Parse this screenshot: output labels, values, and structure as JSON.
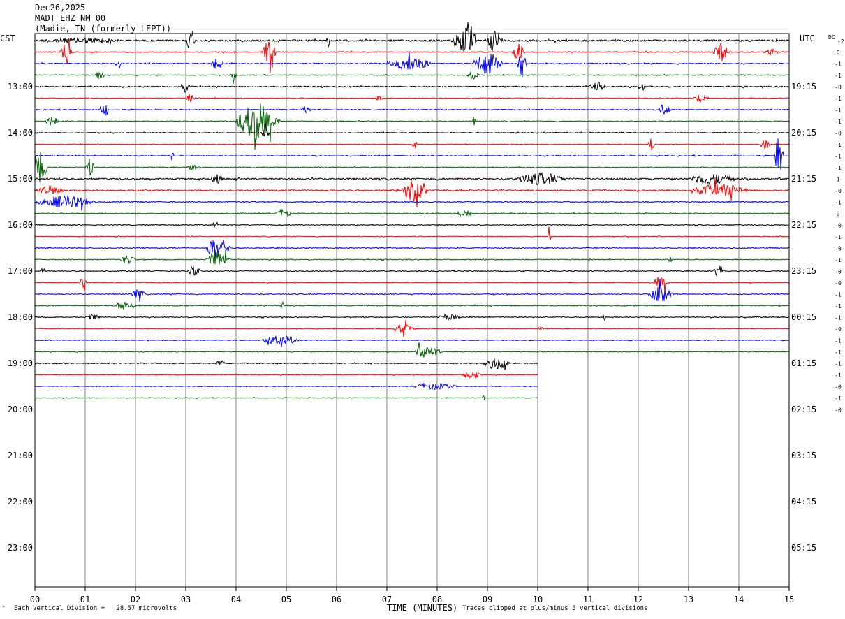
{
  "header": {
    "date": "Dec26,2025",
    "station": "MADT EHZ NM 00",
    "location": "(Madie, TN (formerly LEPT))"
  },
  "left_tz": "CST",
  "right_tz": "UTC",
  "dc_label": "DC",
  "dc_top_value": "-2",
  "footer": {
    "scale_note": "Each Vertical Division =   28.57 microvolts",
    "clip_note": "Traces clipped at plus/minus 5 vertical divisions",
    "corner_mark": "⌃"
  },
  "chart_data": {
    "type": "line",
    "title": "",
    "xlabel": "TIME (MINUTES)",
    "ylabel": "",
    "xlim": [
      0,
      15
    ],
    "x_ticks": [
      "00",
      "01",
      "02",
      "03",
      "04",
      "05",
      "06",
      "07",
      "08",
      "09",
      "10",
      "11",
      "12",
      "13",
      "14",
      "15"
    ],
    "hour_labels_left": [
      "13:00",
      "14:00",
      "15:00",
      "16:00",
      "17:00",
      "18:00",
      "19:00",
      "20:00",
      "21:00",
      "22:00",
      "23:00"
    ],
    "hour_labels_right": [
      "19:15",
      "20:15",
      "21:15",
      "22:15",
      "23:15",
      "00:15",
      "01:15",
      "02:15",
      "03:15",
      "04:15",
      "05:15"
    ],
    "first_hour_row": 4,
    "rows_per_hour": 4,
    "total_rows": 48,
    "trace_colors": [
      "#000000",
      "#ff0000",
      "#0000ff",
      "#006400"
    ],
    "dc_offsets": [
      "0",
      "-1",
      "-1",
      "-0",
      "-1",
      "-1",
      "-1",
      "-0",
      "-1",
      "-1",
      "-1",
      "1",
      "-0",
      "-1",
      "0",
      "-0",
      "-1",
      "-0",
      "-1",
      "-0",
      "-0",
      "-1",
      "-1",
      "-1",
      "-0",
      "-1",
      "-1",
      "-1",
      "-1",
      "-0",
      "-1",
      "-0"
    ],
    "traces": [
      {
        "row": 0,
        "end_minute": 15,
        "noise": 1.0,
        "events": [
          [
            0.0,
            3.0,
            2
          ],
          [
            3.0,
            0.3,
            6
          ],
          [
            8.3,
            0.8,
            9
          ],
          [
            9.0,
            0.5,
            8
          ],
          [
            5.8,
            0.1,
            5
          ]
        ]
      },
      {
        "row": 1,
        "end_minute": 15,
        "noise": 0.6,
        "events": [
          [
            0.5,
            0.4,
            6
          ],
          [
            4.5,
            0.5,
            7
          ],
          [
            9.5,
            0.4,
            6
          ],
          [
            13.5,
            0.5,
            7
          ],
          [
            14.5,
            0.5,
            2
          ]
        ]
      },
      {
        "row": 2,
        "end_minute": 15,
        "noise": 0.6,
        "events": [
          [
            1.6,
            0.2,
            4
          ],
          [
            3.5,
            0.4,
            5
          ],
          [
            7.0,
            1.5,
            4
          ],
          [
            8.7,
            1.0,
            7
          ],
          [
            9.6,
            0.3,
            10
          ]
        ]
      },
      {
        "row": 3,
        "end_minute": 15,
        "noise": 0.5,
        "events": [
          [
            1.2,
            0.3,
            3
          ],
          [
            3.9,
            0.2,
            3
          ],
          [
            8.6,
            0.4,
            3
          ]
        ]
      },
      {
        "row": 4,
        "end_minute": 15,
        "noise": 0.7,
        "events": [
          [
            2.9,
            0.3,
            4
          ],
          [
            11.0,
            0.6,
            3
          ],
          [
            12.0,
            0.2,
            4
          ]
        ]
      },
      {
        "row": 5,
        "end_minute": 15,
        "noise": 0.4,
        "events": [
          [
            3.0,
            0.3,
            3
          ],
          [
            6.8,
            0.2,
            4
          ],
          [
            13.1,
            0.5,
            3
          ]
        ]
      },
      {
        "row": 6,
        "end_minute": 15,
        "noise": 0.5,
        "events": [
          [
            1.3,
            0.3,
            4
          ],
          [
            5.3,
            0.3,
            3
          ],
          [
            12.4,
            0.4,
            4
          ]
        ]
      },
      {
        "row": 7,
        "end_minute": 15,
        "noise": 0.5,
        "events": [
          [
            0.2,
            0.5,
            3
          ],
          [
            4.0,
            1.4,
            12
          ],
          [
            8.7,
            0.1,
            3
          ]
        ]
      },
      {
        "row": 8,
        "end_minute": 15,
        "noise": 0.5,
        "events": [
          [
            4.5,
            0.3,
            3
          ]
        ]
      },
      {
        "row": 9,
        "end_minute": 15,
        "noise": 0.4,
        "events": [
          [
            7.5,
            0.2,
            3
          ],
          [
            12.2,
            0.2,
            4
          ],
          [
            14.4,
            0.4,
            3
          ]
        ]
      },
      {
        "row": 10,
        "end_minute": 15,
        "noise": 0.5,
        "events": [
          [
            2.7,
            0.1,
            4
          ],
          [
            14.7,
            0.3,
            12
          ]
        ]
      },
      {
        "row": 11,
        "end_minute": 15,
        "noise": 0.5,
        "events": [
          [
            0.0,
            0.4,
            12
          ],
          [
            1.0,
            0.3,
            6
          ],
          [
            3.0,
            0.4,
            2
          ]
        ]
      },
      {
        "row": 12,
        "end_minute": 15,
        "noise": 0.9,
        "events": [
          [
            3.5,
            0.4,
            3
          ],
          [
            9.5,
            1.8,
            4
          ],
          [
            13.0,
            1.5,
            4
          ]
        ]
      },
      {
        "row": 13,
        "end_minute": 15,
        "noise": 0.8,
        "events": [
          [
            0.0,
            1.0,
            3
          ],
          [
            7.3,
            0.8,
            7
          ],
          [
            13.0,
            2.0,
            4
          ]
        ]
      },
      {
        "row": 14,
        "end_minute": 15,
        "noise": 0.6,
        "events": [
          [
            0.0,
            2.0,
            4
          ]
        ]
      },
      {
        "row": 15,
        "end_minute": 15,
        "noise": 0.5,
        "events": [
          [
            4.8,
            0.5,
            3
          ],
          [
            8.4,
            0.5,
            3
          ]
        ]
      },
      {
        "row": 16,
        "end_minute": 15,
        "noise": 0.5,
        "events": [
          [
            3.5,
            0.3,
            2
          ]
        ]
      },
      {
        "row": 17,
        "end_minute": 15,
        "noise": 0.4,
        "events": [
          [
            10.2,
            0.1,
            7
          ]
        ]
      },
      {
        "row": 18,
        "end_minute": 15,
        "noise": 0.5,
        "events": [
          [
            3.4,
            0.8,
            7
          ]
        ]
      },
      {
        "row": 19,
        "end_minute": 15,
        "noise": 0.5,
        "events": [
          [
            1.7,
            0.5,
            3
          ],
          [
            3.4,
            0.8,
            5
          ],
          [
            12.6,
            0.1,
            5
          ]
        ]
      },
      {
        "row": 20,
        "end_minute": 15,
        "noise": 0.5,
        "events": [
          [
            0.1,
            0.2,
            3
          ],
          [
            3.0,
            0.5,
            3
          ],
          [
            13.5,
            0.4,
            4
          ]
        ]
      },
      {
        "row": 21,
        "end_minute": 15,
        "noise": 0.4,
        "events": [
          [
            0.9,
            0.2,
            4
          ],
          [
            12.3,
            0.5,
            5
          ]
        ]
      },
      {
        "row": 22,
        "end_minute": 15,
        "noise": 0.5,
        "events": [
          [
            1.9,
            0.5,
            3
          ],
          [
            12.2,
            0.8,
            5
          ]
        ]
      },
      {
        "row": 23,
        "end_minute": 15,
        "noise": 0.5,
        "events": [
          [
            1.6,
            0.7,
            3
          ],
          [
            4.9,
            0.1,
            4
          ]
        ]
      },
      {
        "row": 24,
        "end_minute": 15,
        "noise": 0.5,
        "events": [
          [
            1.0,
            0.5,
            2
          ],
          [
            8.0,
            0.8,
            2
          ],
          [
            11.3,
            0.1,
            5
          ]
        ]
      },
      {
        "row": 25,
        "end_minute": 15,
        "noise": 0.4,
        "events": [
          [
            7.1,
            0.8,
            3
          ],
          [
            10.0,
            0.2,
            2
          ]
        ]
      },
      {
        "row": 26,
        "end_minute": 15,
        "noise": 0.4,
        "events": [
          [
            4.5,
            1.3,
            3
          ]
        ]
      },
      {
        "row": 27,
        "end_minute": 15,
        "noise": 0.4,
        "events": [
          [
            7.5,
            1.0,
            4
          ]
        ]
      },
      {
        "row": 28,
        "end_minute": 10,
        "noise": 0.5,
        "events": [
          [
            3.6,
            0.3,
            2
          ],
          [
            8.9,
            0.9,
            4
          ]
        ]
      },
      {
        "row": 29,
        "end_minute": 10,
        "noise": 0.4,
        "events": [
          [
            8.5,
            0.6,
            3
          ]
        ]
      },
      {
        "row": 30,
        "end_minute": 10,
        "noise": 0.4,
        "events": [
          [
            7.5,
            1.5,
            2
          ]
        ]
      },
      {
        "row": 31,
        "end_minute": 10,
        "noise": 0.4,
        "events": [
          [
            8.9,
            0.1,
            5
          ]
        ]
      }
    ]
  }
}
